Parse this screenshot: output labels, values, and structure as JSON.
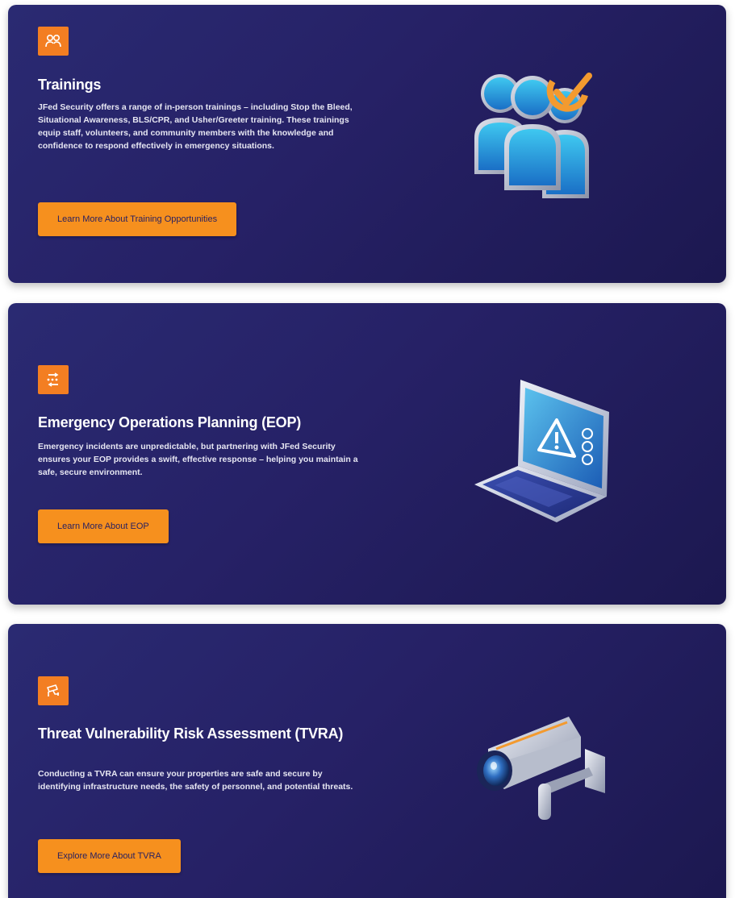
{
  "colors": {
    "card_background": "#262166",
    "accent": "#f37e22",
    "button": "#f6901e",
    "button_text": "#2a2160",
    "title_text": "#ffffff"
  },
  "cards": [
    {
      "icon": "people-icon",
      "title": "Trainings",
      "description": "JFed Security offers a range of in-person trainings – including Stop the Bleed, Situational Awareness, BLS/CPR, and Usher/Greeter training. These trainings equip staff, volunteers, and community members with the knowledge and confidence to respond effectively in emergency situations.",
      "button_label": "Learn More About Training Opportunities",
      "illustration": "people-with-checkmark-illustration"
    },
    {
      "icon": "route-icon",
      "title": "Emergency Operations Planning (EOP)",
      "description": "Emergency incidents are unpredictable, but partnering with JFed Security ensures your EOP provides a swift, effective response – helping you maintain a safe, secure environment.",
      "button_label": "Learn More About EOP",
      "illustration": "laptop-warning-illustration"
    },
    {
      "icon": "cctv-icon",
      "title": "Threat Vulnerability Risk Assessment (TVRA)",
      "description": "Conducting a TVRA can ensure your properties are safe and secure by identifying infrastructure needs, the safety of personnel, and potential threats.",
      "button_label": "Explore More About TVRA",
      "illustration": "security-camera-illustration"
    }
  ]
}
